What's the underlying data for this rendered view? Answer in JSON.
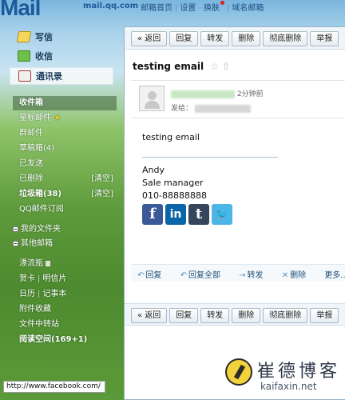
{
  "header": {
    "logo_text": "Mail",
    "domain": "mail.qq.com",
    "links": [
      "邮箱首页",
      "设置",
      "换肤",
      "域名邮箱"
    ]
  },
  "sidebar": {
    "compose": "写信",
    "receive": "收信",
    "contacts": "通讯录",
    "folders": [
      {
        "label": "收件箱"
      },
      {
        "label": "星标邮件"
      },
      {
        "label": "群邮件"
      },
      {
        "label": "草稿箱(4)"
      },
      {
        "label": "已发送"
      },
      {
        "label": "已删除",
        "action": "[清空]"
      },
      {
        "label": "垃圾箱(38)",
        "action": "[清空]"
      },
      {
        "label": "QQ邮件订阅"
      }
    ],
    "my_folders": "我的文件夹",
    "other_mailbox": "其他邮箱",
    "drift_bottle": "漂流瓶",
    "card": "贺卡",
    "postcard": "明信片",
    "calendar": "日历",
    "notepad": "记事本",
    "attachments": "附件收藏",
    "transfer": "文件中转站",
    "reading": "阅读空间(169+1)"
  },
  "status_tip": "http://www.facebook.com/",
  "toolbar": {
    "back": "« 返回",
    "reply": "回复",
    "forward": "转发",
    "delete": "删除",
    "perm_delete": "彻底删除",
    "report": "举报"
  },
  "email": {
    "subject": "testing email",
    "time": "2分钟前",
    "to_label": "发给：",
    "body_text": "testing email",
    "signature_name": "Andy",
    "signature_title": "Sale manager",
    "signature_phone": "010-88888888"
  },
  "actions": {
    "reply": "回复",
    "reply_all": "回复全部",
    "forward": "转发",
    "delete": "删除",
    "more": "更多..."
  },
  "watermark": {
    "title": "崔德博客",
    "url": "kaifaxin.net"
  }
}
